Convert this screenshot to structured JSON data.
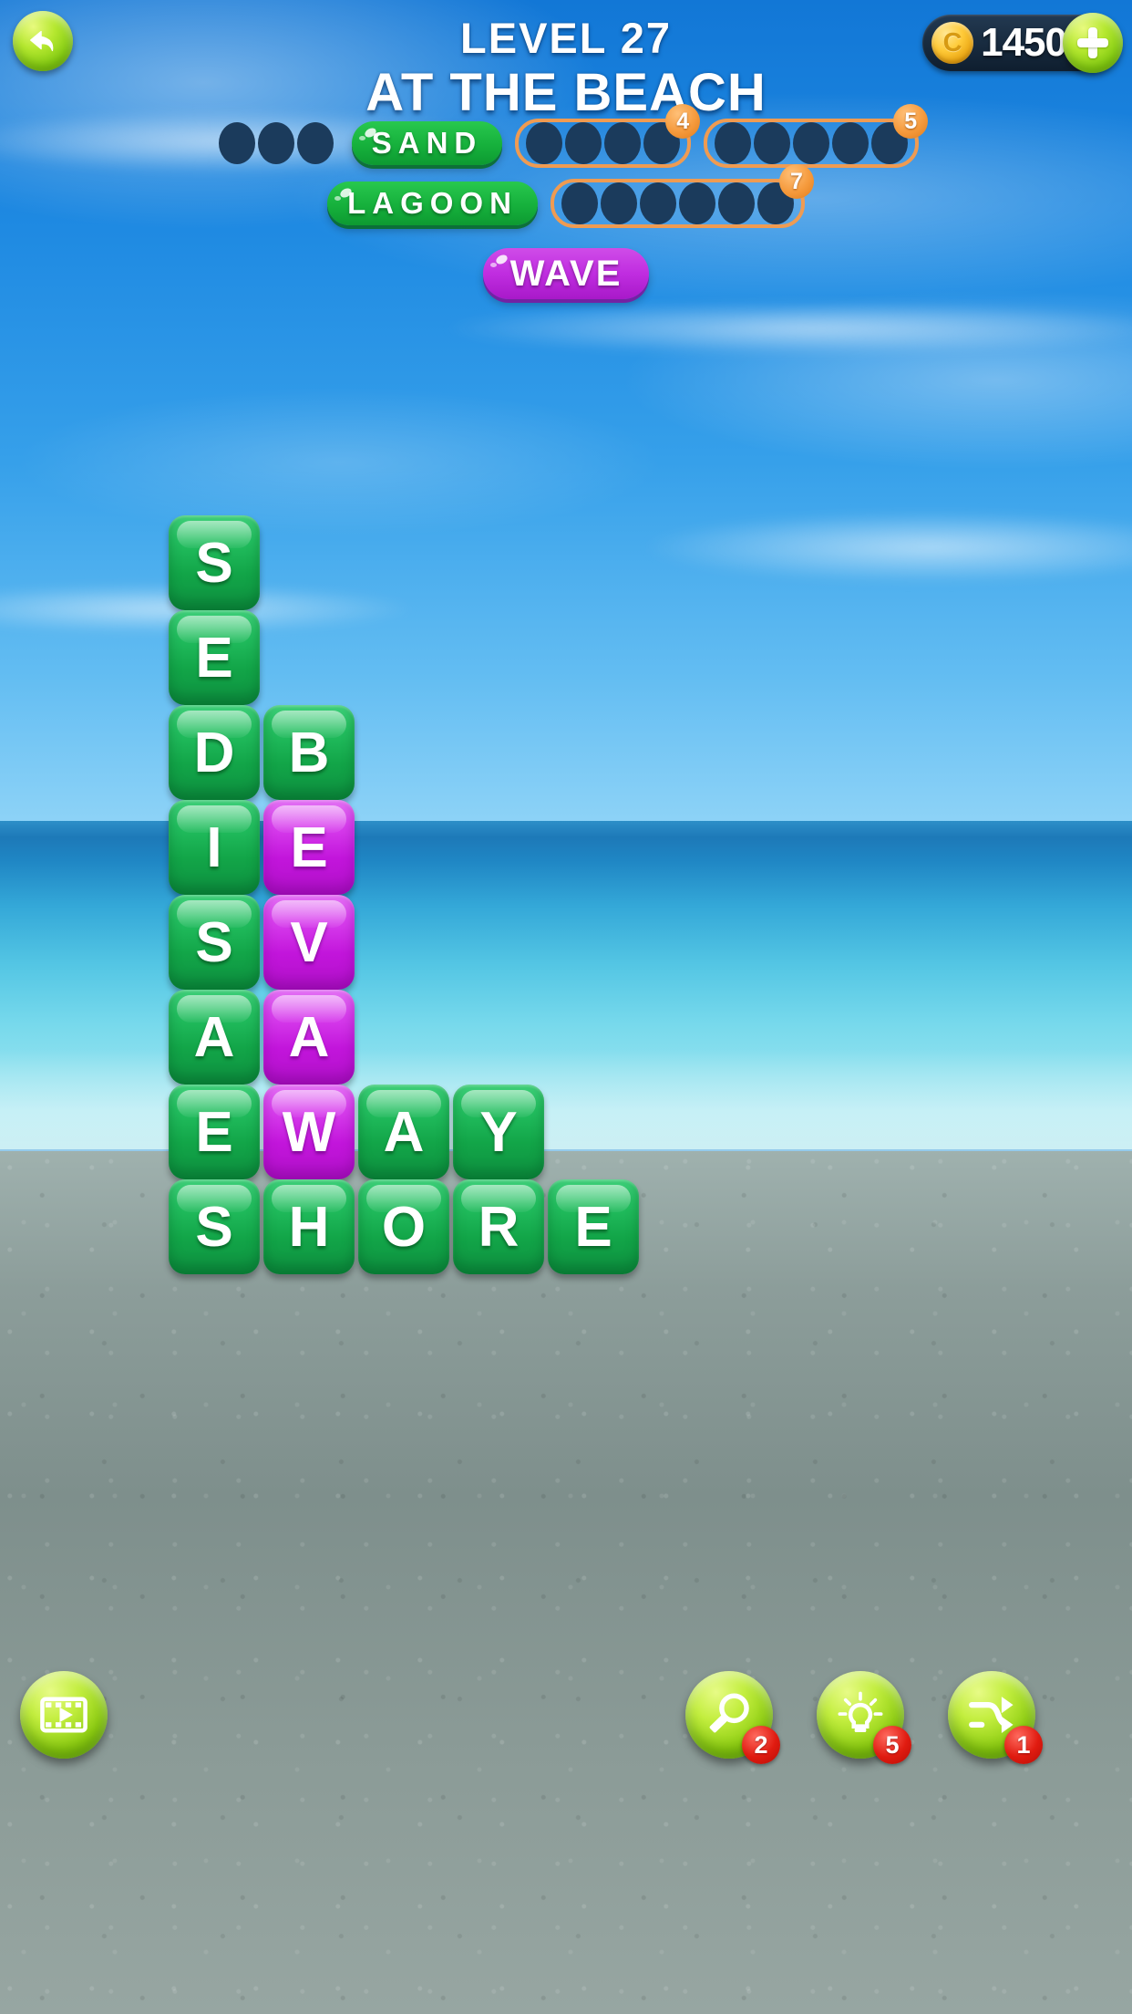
{
  "header": {
    "level_label": "LEVEL 27",
    "theme": "AT THE BEACH",
    "back_icon": "back-arrow-icon",
    "coins": {
      "icon": "coin-icon",
      "glyph": "C",
      "amount": "1450",
      "add_label": "plus-icon"
    }
  },
  "word_slots": {
    "row1": [
      {
        "type": "unsolved",
        "letters": 3,
        "boxed": false,
        "badge": null
      },
      {
        "type": "solved",
        "word": "SAND",
        "color": "#12b03c"
      },
      {
        "type": "unsolved",
        "letters": 4,
        "boxed": true,
        "badge": "4"
      },
      {
        "type": "unsolved",
        "letters": 5,
        "boxed": true,
        "badge": "5"
      }
    ],
    "row2": [
      {
        "type": "solved",
        "word": "LAGOON",
        "color": "#12b03c"
      },
      {
        "type": "unsolved",
        "letters": 6,
        "boxed": true,
        "badge": "7"
      }
    ],
    "row3": [
      {
        "type": "solved",
        "word": "WAVE",
        "color": "#c02de0",
        "style": "purple"
      }
    ]
  },
  "grid": {
    "tiles": [
      {
        "letter": "S",
        "col": 0,
        "row": 0,
        "color": "green"
      },
      {
        "letter": "E",
        "col": 0,
        "row": 1,
        "color": "green"
      },
      {
        "letter": "D",
        "col": 0,
        "row": 2,
        "color": "green"
      },
      {
        "letter": "B",
        "col": 1,
        "row": 2,
        "color": "green"
      },
      {
        "letter": "I",
        "col": 0,
        "row": 3,
        "color": "green"
      },
      {
        "letter": "E",
        "col": 1,
        "row": 3,
        "color": "purple"
      },
      {
        "letter": "S",
        "col": 0,
        "row": 4,
        "color": "green"
      },
      {
        "letter": "V",
        "col": 1,
        "row": 4,
        "color": "purple"
      },
      {
        "letter": "A",
        "col": 0,
        "row": 5,
        "color": "green"
      },
      {
        "letter": "A",
        "col": 1,
        "row": 5,
        "color": "purple"
      },
      {
        "letter": "E",
        "col": 0,
        "row": 6,
        "color": "green"
      },
      {
        "letter": "W",
        "col": 1,
        "row": 6,
        "color": "purple"
      },
      {
        "letter": "A",
        "col": 2,
        "row": 6,
        "color": "green"
      },
      {
        "letter": "Y",
        "col": 3,
        "row": 6,
        "color": "green"
      },
      {
        "letter": "S",
        "col": 0,
        "row": 7,
        "color": "green"
      },
      {
        "letter": "H",
        "col": 1,
        "row": 7,
        "color": "green"
      },
      {
        "letter": "O",
        "col": 2,
        "row": 7,
        "color": "green"
      },
      {
        "letter": "R",
        "col": 3,
        "row": 7,
        "color": "green"
      },
      {
        "letter": "E",
        "col": 4,
        "row": 7,
        "color": "green"
      }
    ]
  },
  "toolbar": {
    "video": {
      "icon": "video-play-icon",
      "badge": null
    },
    "buttons": [
      {
        "icon": "magnifier-icon",
        "badge": "2"
      },
      {
        "icon": "lightbulb-icon",
        "badge": "5"
      },
      {
        "icon": "shuffle-icon",
        "badge": "1"
      }
    ]
  }
}
